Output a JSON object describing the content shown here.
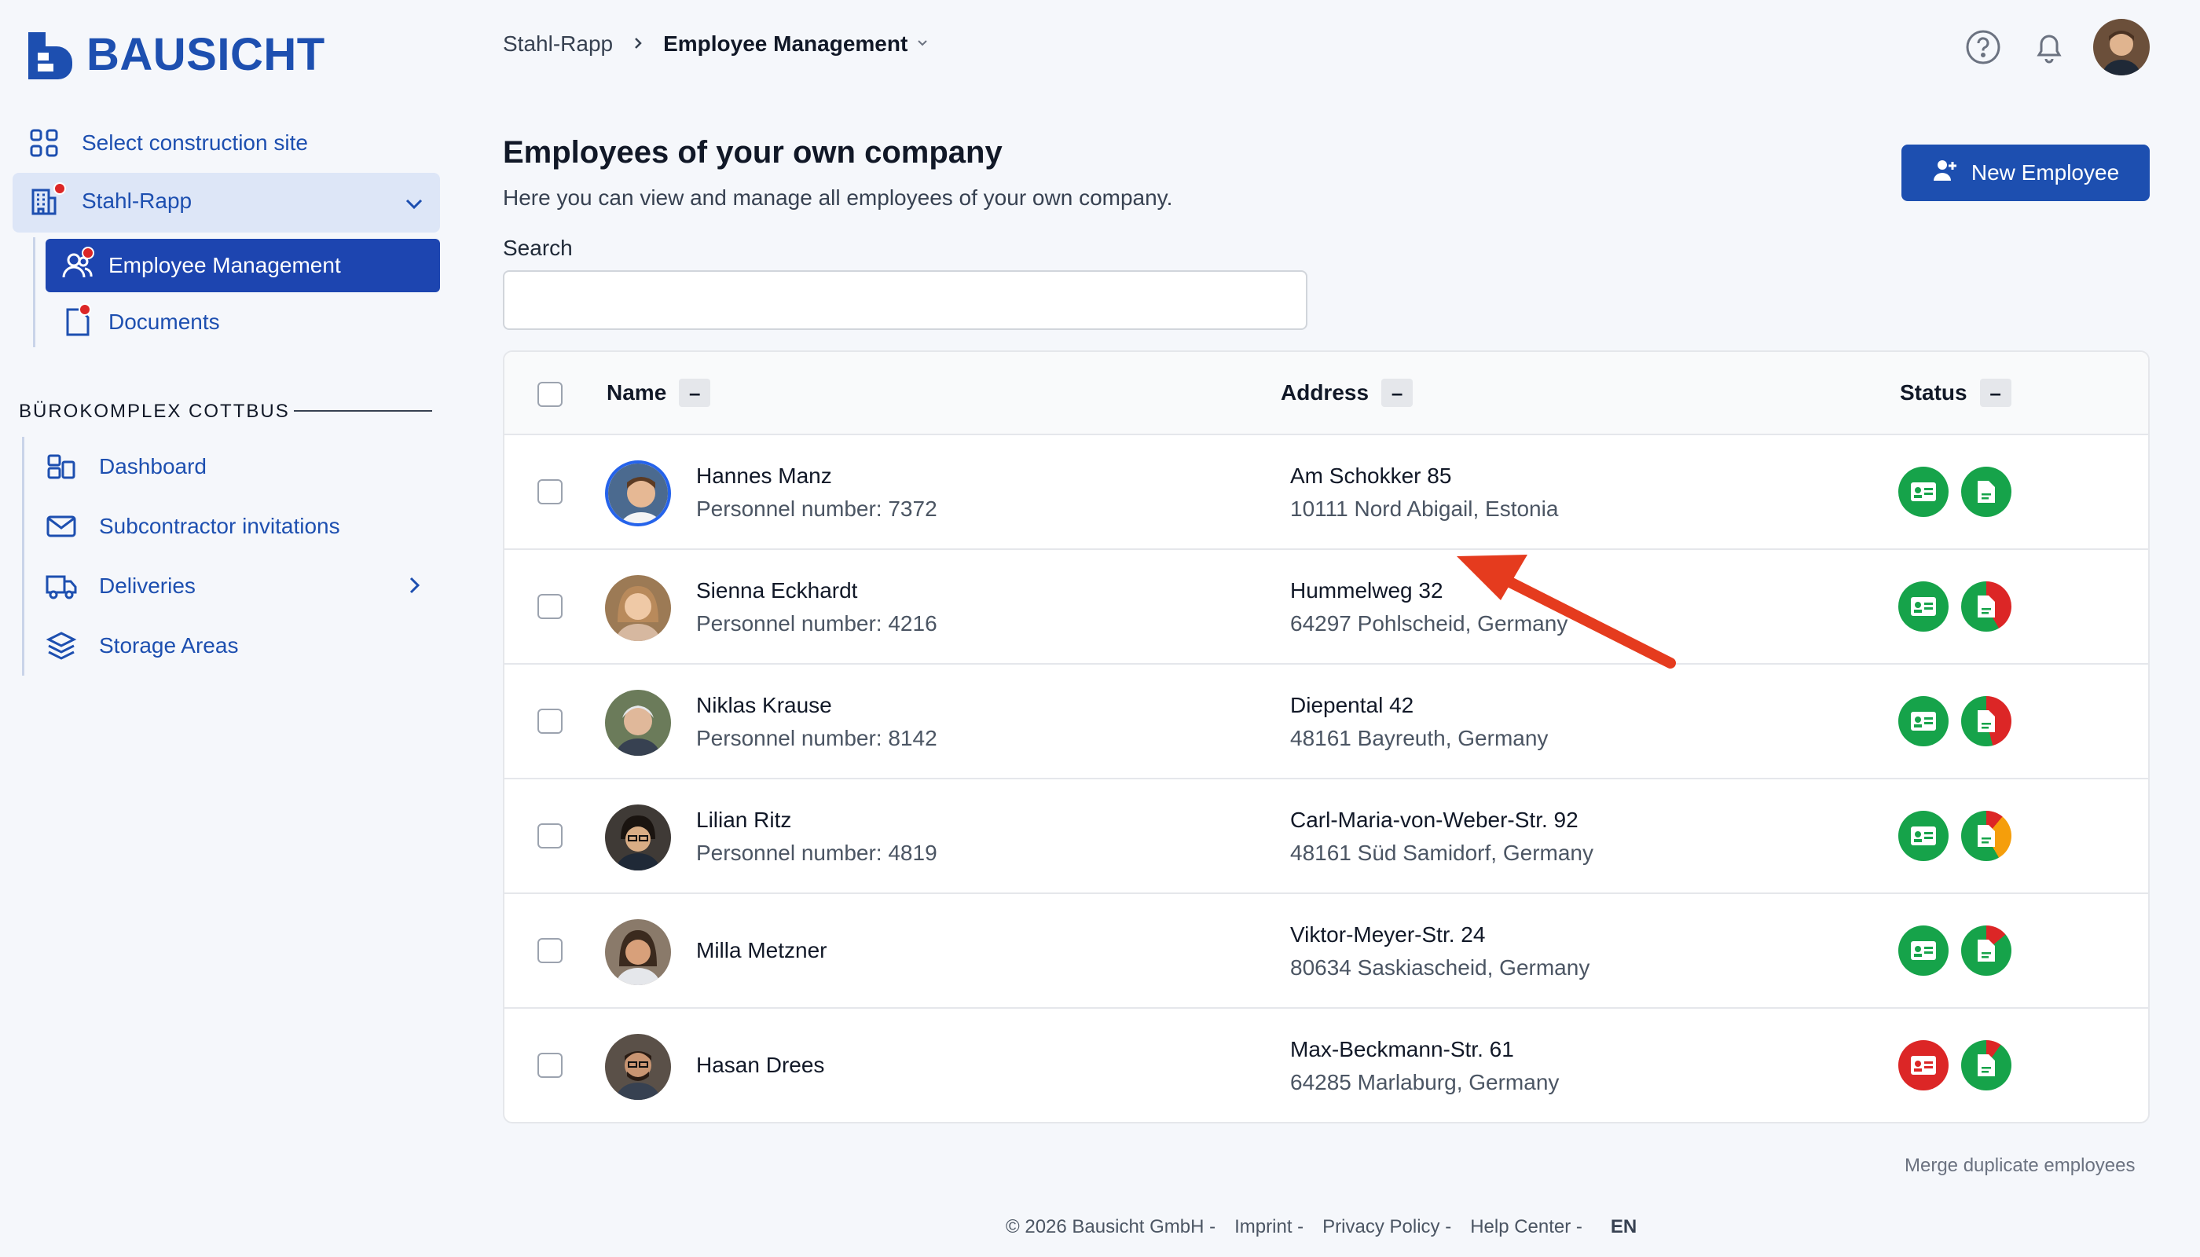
{
  "brand": {
    "name": "BAUSICHT",
    "color": "#1d4fb0"
  },
  "sidebar": {
    "select_site_label": "Select construction site",
    "company": "Stahl-Rapp",
    "company_items": [
      {
        "label": "Employee Management",
        "active": true
      },
      {
        "label": "Documents",
        "active": false
      }
    ],
    "section_title": "BÜROKOMPLEX COTTBUS",
    "section_items": [
      {
        "label": "Dashboard"
      },
      {
        "label": "Subcontractor invitations"
      },
      {
        "label": "Deliveries"
      },
      {
        "label": "Storage Areas"
      }
    ]
  },
  "header": {
    "breadcrumb": [
      "Stahl-Rapp",
      "Employee Management"
    ]
  },
  "main": {
    "title": "Employees of your own company",
    "subtitle": "Here you can view and manage all employees of your own company.",
    "new_button": "New Employee",
    "search": {
      "label": "Search",
      "value": "",
      "placeholder": ""
    },
    "table": {
      "columns": [
        "Name",
        "Address",
        "Status"
      ],
      "collapse_symbol": "–",
      "rows": [
        {
          "name": "Hannes Manz",
          "personnel": "Personnel number: 7372",
          "street": "Am Schokker 85",
          "city": "10111 Nord Abigail, Estonia",
          "id_status": "green",
          "doc_status": "complete"
        },
        {
          "name": "Sienna Eckhardt",
          "personnel": "Personnel number: 4216",
          "street": "Hummelweg 32",
          "city": "64297 Pohlscheid, Germany",
          "id_status": "green",
          "doc_status": "partial-red"
        },
        {
          "name": "Niklas Krause",
          "personnel": "Personnel number: 8142",
          "street": "Diepental 42",
          "city": "48161 Bayreuth, Germany",
          "id_status": "green",
          "doc_status": "partial-red"
        },
        {
          "name": "Lilian Ritz",
          "personnel": "Personnel number: 4819",
          "street": "Carl-Maria-von-Weber-Str. 92",
          "city": "48161 Süd Samidorf, Germany",
          "id_status": "green",
          "doc_status": "partial-orange"
        },
        {
          "name": "Milla Metzner",
          "personnel": "",
          "street": "Viktor-Meyer-Str. 24",
          "city": "80634 Saskiascheid, Germany",
          "id_status": "green",
          "doc_status": "small-red"
        },
        {
          "name": "Hasan Drees",
          "personnel": "",
          "street": "Max-Beckmann-Str. 61",
          "city": "64285 Marlaburg, Germany",
          "id_status": "red",
          "doc_status": "small-red"
        }
      ]
    },
    "merge_link": "Merge duplicate employees"
  },
  "footer": {
    "copyright": "© 2026 Bausicht GmbH -",
    "links": [
      "Imprint -",
      "Privacy Policy -",
      "Help Center -"
    ],
    "language": "EN"
  },
  "colors": {
    "status_green": "#16a34a",
    "status_red": "#dc2626",
    "status_orange": "#f59e0b",
    "annotation_arrow": "#e53b1e"
  },
  "icons": [
    "help-circle-icon",
    "bell-icon",
    "grid-icon",
    "building-icon",
    "users-icon",
    "document-icon",
    "dashboard-icon",
    "envelope-icon",
    "truck-icon",
    "layers-icon",
    "chevron-down-icon",
    "chevron-right-icon",
    "user-plus-icon",
    "id-card-icon",
    "file-icon"
  ]
}
